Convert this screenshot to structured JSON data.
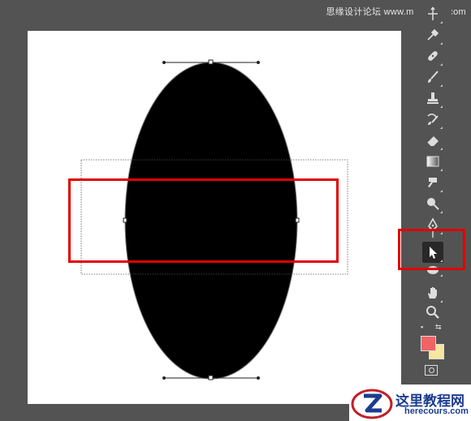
{
  "watermark": {
    "top_text": "思缘设计论坛 www.missyuan.com"
  },
  "logo": {
    "cn": "这里教程网",
    "en": "herecours.com"
  },
  "colors": {
    "foreground": "#f06464",
    "background": "#f5e6a0",
    "highlight": "#e00000",
    "shape": "#000000"
  },
  "toolbar": {
    "tools": [
      {
        "name": "move-tool",
        "icon": "move-icon"
      },
      {
        "name": "eyedropper-tool",
        "icon": "eyedropper-icon"
      },
      {
        "name": "healing-brush-tool",
        "icon": "bandage-icon"
      },
      {
        "name": "brush-tool",
        "icon": "brush-icon"
      },
      {
        "name": "clone-stamp-tool",
        "icon": "stamp-icon"
      },
      {
        "name": "history-brush-tool",
        "icon": "history-brush-icon"
      },
      {
        "name": "eraser-tool",
        "icon": "eraser-icon"
      },
      {
        "name": "gradient-tool",
        "icon": "gradient-icon"
      },
      {
        "name": "smudge-tool",
        "icon": "finger-icon"
      },
      {
        "name": "dodge-tool",
        "icon": "dodge-icon"
      },
      {
        "name": "pen-tool",
        "icon": "pen-icon"
      },
      {
        "name": "type-tool",
        "icon": "type-icon"
      },
      {
        "name": "direct-selection-tool",
        "icon": "arrow-icon",
        "active": true
      },
      {
        "name": "ellipse-tool",
        "icon": "ellipse-icon"
      },
      {
        "name": "hand-tool",
        "icon": "hand-icon"
      },
      {
        "name": "zoom-tool",
        "icon": "magnifier-icon"
      }
    ]
  }
}
